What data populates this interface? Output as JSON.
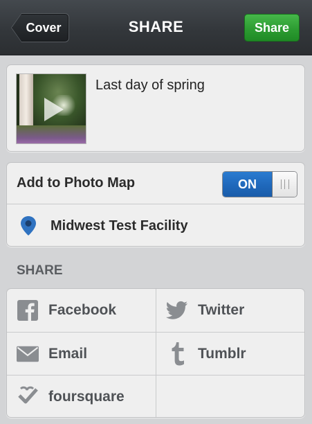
{
  "header": {
    "title": "SHARE",
    "back_label": "Cover",
    "share_label": "Share"
  },
  "post": {
    "caption": "Last day of spring",
    "thumbnail": "video-thumbnail"
  },
  "photo_map": {
    "label": "Add to Photo Map",
    "toggle_state": "ON",
    "location": "Midwest Test Facility",
    "location_icon": "location-pin-icon"
  },
  "share": {
    "section_title": "SHARE",
    "services": [
      {
        "label": "Facebook",
        "icon": "facebook-icon"
      },
      {
        "label": "Twitter",
        "icon": "twitter-icon"
      },
      {
        "label": "Email",
        "icon": "email-icon"
      },
      {
        "label": "Tumblr",
        "icon": "tumblr-icon"
      },
      {
        "label": "foursquare",
        "icon": "foursquare-icon"
      }
    ]
  },
  "colors": {
    "accent_green": "#2b9a30",
    "toggle_blue": "#1f68bb",
    "pin_blue": "#2f72c0"
  }
}
